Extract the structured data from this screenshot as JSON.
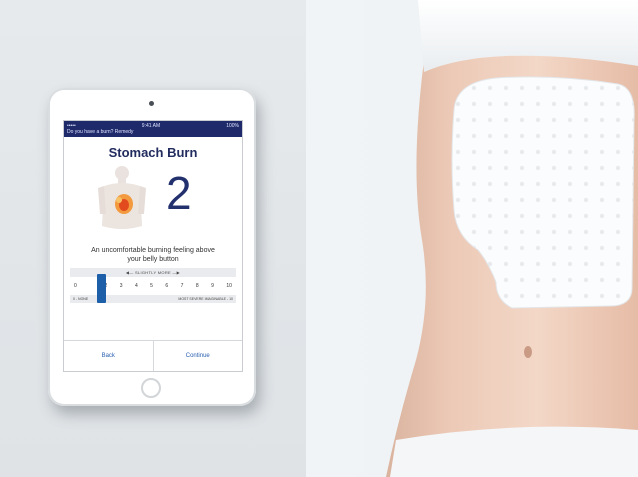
{
  "app": {
    "header_text": "Do you have a burn? Remedy",
    "time": "9:41 AM",
    "battery": "100%"
  },
  "screen": {
    "title": "Stomach Burn",
    "score": "2",
    "description": "An uncomfortable burning feeling above your belly button"
  },
  "scale": {
    "header": "◀— SLIGHTLY MORE —▶",
    "numbers": [
      "0",
      "1",
      "2",
      "3",
      "4",
      "5",
      "6",
      "7",
      "8",
      "9",
      "10"
    ],
    "selected_value": 1,
    "left_label": "0 - NONE",
    "right_label": "MOST SEVERE IMAGINABLE - 10"
  },
  "buttons": {
    "back": "Back",
    "continue": "Continue"
  },
  "colors": {
    "header_bg": "#1f2a6b",
    "accent": "#1d5fa8",
    "title": "#222c5e"
  }
}
